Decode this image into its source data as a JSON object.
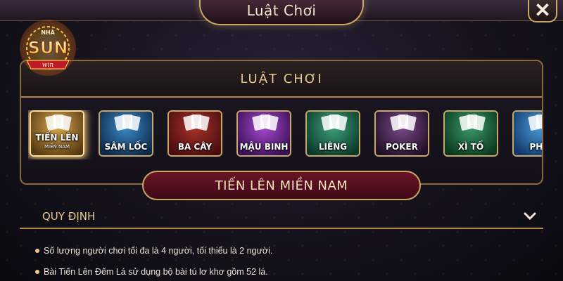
{
  "window": {
    "title": "Luật Chơi",
    "close_label": "✕"
  },
  "logo": {
    "brand_text": "SUN",
    "top_text": "NHÀ",
    "bottom_text": "win"
  },
  "panel": {
    "header": "LUẬT CHƠI",
    "games": [
      {
        "line1": "TIẾN LÊN",
        "line2": "MIỀN NAM",
        "active": true,
        "colors": [
          "#d9a94e",
          "#5a3a12"
        ]
      },
      {
        "line1": "SÂM LỐC",
        "line2": "",
        "active": false,
        "colors": [
          "#3a8ac8",
          "#0f2a4a"
        ]
      },
      {
        "line1": "BA CÂY",
        "line2": "",
        "active": false,
        "colors": [
          "#a8322a",
          "#4a0e10"
        ]
      },
      {
        "line1": "MẬU BINH",
        "line2": "",
        "active": false,
        "colors": [
          "#a54ad0",
          "#3a0f55"
        ]
      },
      {
        "line1": "LIÊNG",
        "line2": "",
        "active": false,
        "colors": [
          "#3fa27a",
          "#0c3a2a"
        ]
      },
      {
        "line1": "POKER",
        "line2": "",
        "active": false,
        "colors": [
          "#7a4a8a",
          "#221028"
        ]
      },
      {
        "line1": "XÌ TỐ",
        "line2": "",
        "active": false,
        "colors": [
          "#3a9a6a",
          "#0c3a20"
        ]
      },
      {
        "line1": "PHỎ",
        "line2": "",
        "active": false,
        "colors": [
          "#4a9ad8",
          "#123a6a"
        ]
      }
    ]
  },
  "game_name": "TIẾN LÊN MIỀN NAM",
  "rules": {
    "title": "QUY ĐỊNH",
    "items": [
      "Số lượng người chơi tối đa là 4 người, tối thiểu là 2 người.",
      "Bài Tiến Lên Đếm Lá sử dụng bộ bài tú lơ khơ gồm 52 lá."
    ]
  },
  "colors": {
    "gold": "#c9a766",
    "header_text": "#e8c98a",
    "pill": "#6a1426"
  }
}
